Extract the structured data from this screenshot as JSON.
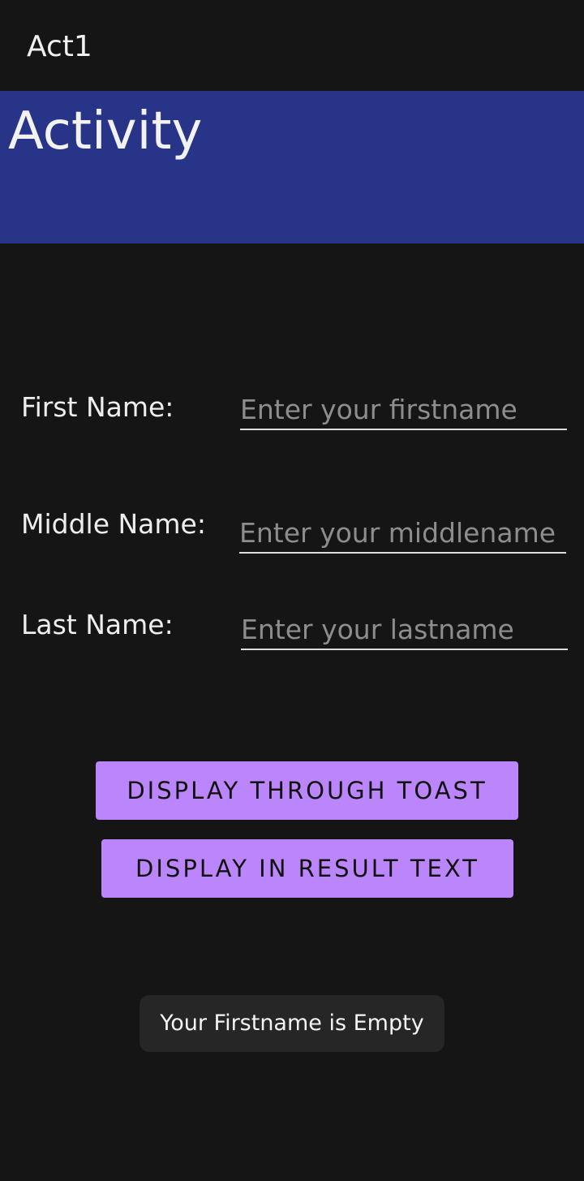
{
  "app_bar": {
    "title": "Act1"
  },
  "banner": {
    "title": "Activity",
    "color": "#283488"
  },
  "form": {
    "first_name": {
      "label": "First Name:",
      "value": "",
      "placeholder": "Enter your firstname"
    },
    "middle_name": {
      "label": "Middle Name:",
      "value": "",
      "placeholder": "Enter your middlename"
    },
    "last_name": {
      "label": "Last Name:",
      "value": "",
      "placeholder": "Enter your lastname"
    }
  },
  "buttons": {
    "toast_label": "DISPLAY THROUGH TOAST",
    "result_label": "DISPLAY IN RESULT TEXT",
    "color": "#bb86fc"
  },
  "toast": {
    "message": "Your Firstname is Empty"
  }
}
